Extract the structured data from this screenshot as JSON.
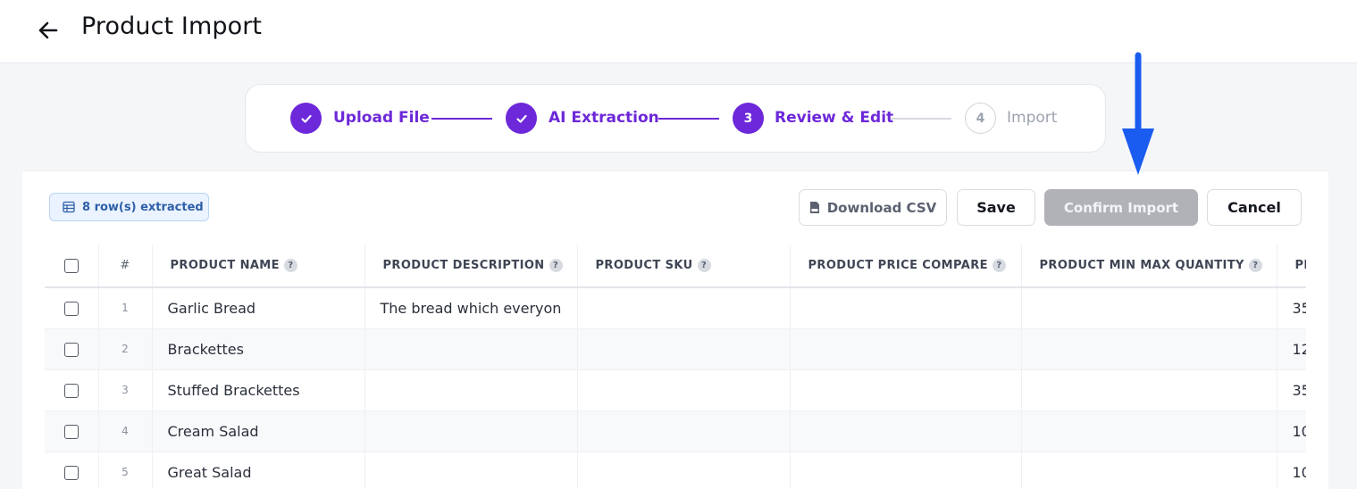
{
  "header": {
    "title": "Product Import"
  },
  "stepper": {
    "steps": [
      {
        "label": "Upload File",
        "state": "done"
      },
      {
        "label": "AI Extraction",
        "state": "done"
      },
      {
        "label": "Review & Edit",
        "state": "active",
        "number": "3"
      },
      {
        "label": "Import",
        "state": "pending",
        "number": "4"
      }
    ]
  },
  "toolbar": {
    "rows_badge": "8 row(s) extracted",
    "download_label": "Download CSV",
    "save_label": "Save",
    "confirm_label": "Confirm Import",
    "cancel_label": "Cancel"
  },
  "table": {
    "columns": [
      {
        "label": "#"
      },
      {
        "label": "PRODUCT NAME"
      },
      {
        "label": "PRODUCT DESCRIPTION"
      },
      {
        "label": "PRODUCT SKU"
      },
      {
        "label": "PRODUCT PRICE COMPARE"
      },
      {
        "label": "PRODUCT MIN MAX QUANTITY"
      },
      {
        "label": "PR"
      }
    ],
    "help_glyph": "?",
    "rows": [
      {
        "num": "1",
        "name": "Garlic Bread",
        "description": "The bread which everyon",
        "sku": "",
        "price_compare": "",
        "min_max": "",
        "price": "35"
      },
      {
        "num": "2",
        "name": "Brackettes",
        "description": "",
        "sku": "",
        "price_compare": "",
        "min_max": "",
        "price": "12"
      },
      {
        "num": "3",
        "name": "Stuffed Brackettes",
        "description": "",
        "sku": "",
        "price_compare": "",
        "min_max": "",
        "price": "35"
      },
      {
        "num": "4",
        "name": "Cream Salad",
        "description": "",
        "sku": "",
        "price_compare": "",
        "min_max": "",
        "price": "10"
      },
      {
        "num": "5",
        "name": "Great Salad",
        "description": "",
        "sku": "",
        "price_compare": "",
        "min_max": "",
        "price": "10"
      }
    ]
  },
  "colors": {
    "accent": "#6d28d9",
    "arrow": "#1a5cf0",
    "badge_text": "#2e5fa8",
    "confirm_disabled": "#b0b2b7"
  },
  "icons": {
    "back": "arrow-left-icon",
    "check": "check-icon",
    "table": "table-icon",
    "csv": "csv-file-icon",
    "annotation": "arrow-down-icon"
  }
}
